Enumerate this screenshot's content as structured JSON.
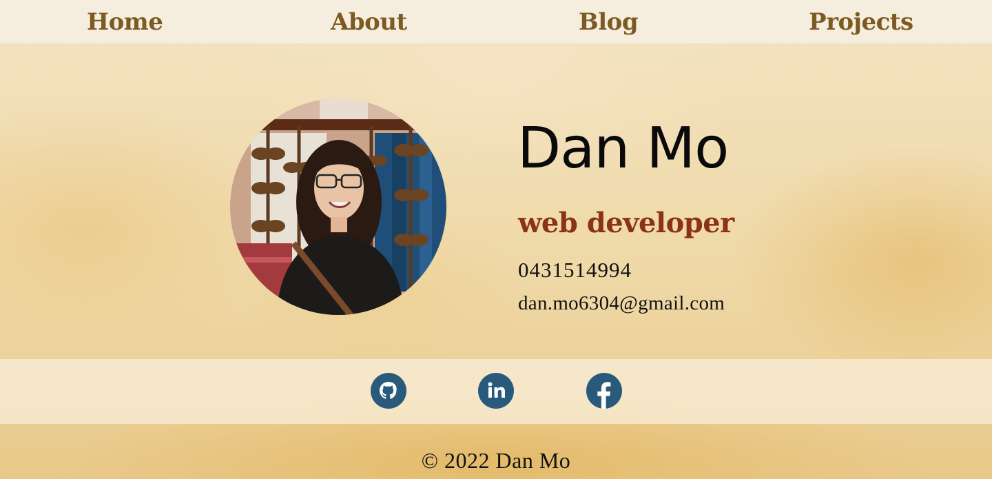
{
  "nav": {
    "items": [
      {
        "label": "Home"
      },
      {
        "label": "About"
      },
      {
        "label": "Blog"
      },
      {
        "label": "Projects"
      }
    ]
  },
  "profile": {
    "name": "Dan Mo",
    "role": "web developer",
    "phone": "0431514994",
    "email": "dan.mo6304@gmail.com"
  },
  "social": {
    "icons": [
      "github-icon",
      "linkedin-icon",
      "facebook-icon"
    ],
    "icon_color": "#295a7b"
  },
  "footer": {
    "copyright": "© 2022 Dan Mo"
  },
  "colors": {
    "nav_text": "#7d5a22",
    "role_text": "#8b3316",
    "nav_bg": "#f5eedf"
  }
}
